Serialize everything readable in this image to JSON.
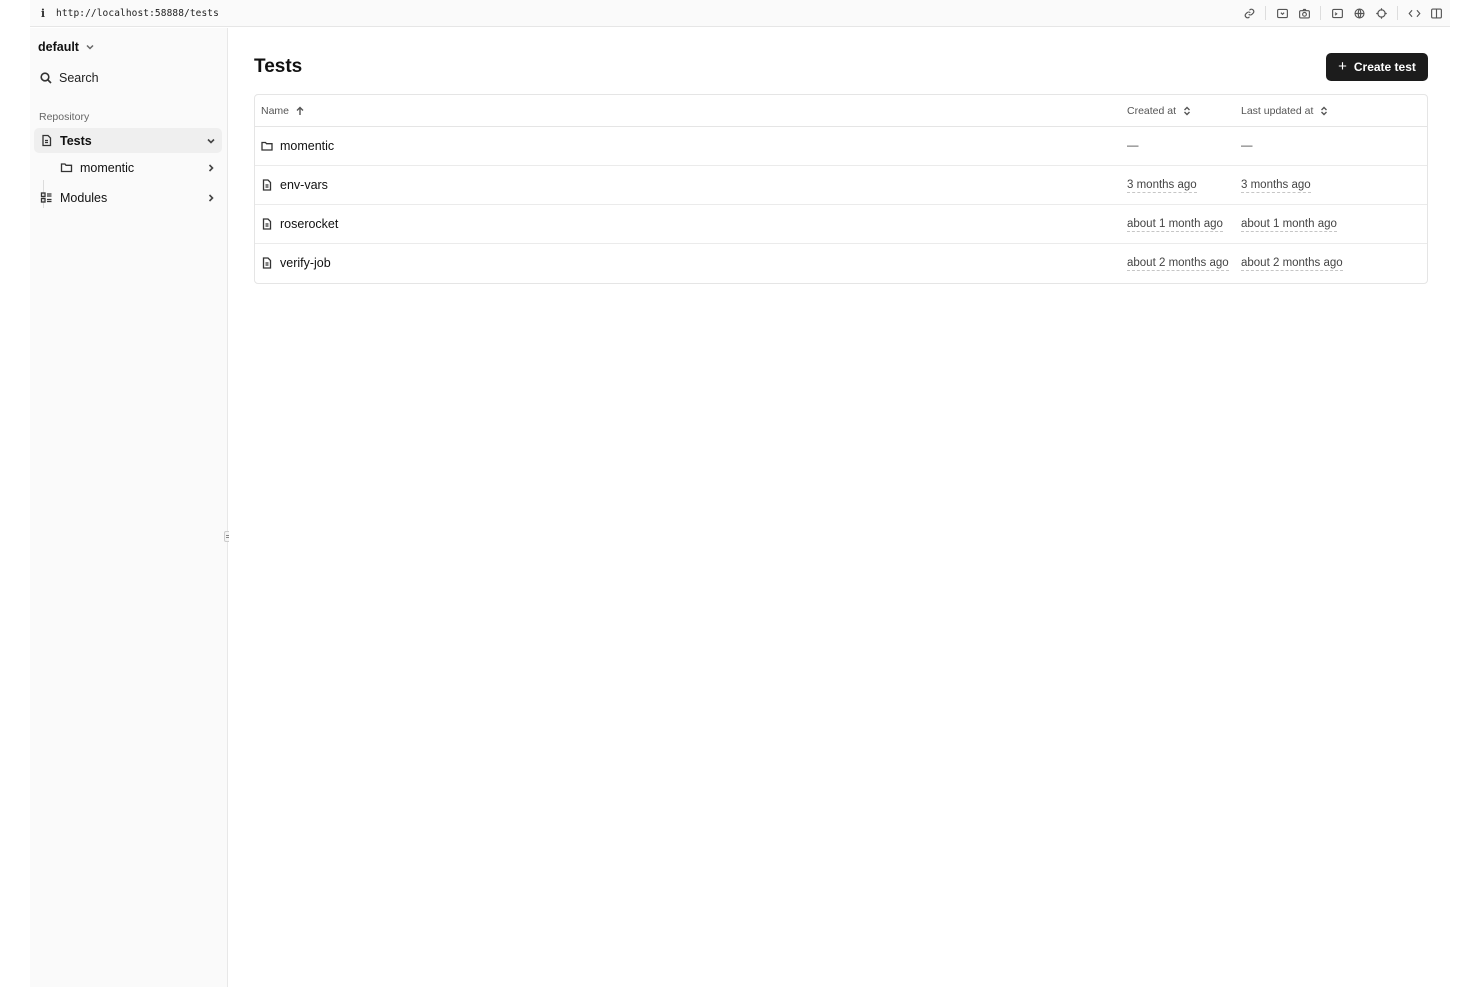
{
  "browser": {
    "url": "http://localhost:58888/tests",
    "info_glyph": "i",
    "tools": [
      "link-icon",
      "screenshot-area-icon",
      "camera-icon",
      "terminal-icon",
      "globe-icon",
      "crosshair-icon",
      "code-icon",
      "split-view-icon"
    ]
  },
  "sidebar": {
    "workspace": "default",
    "search_label": "Search",
    "section_label": "Repository",
    "items": [
      {
        "label": "Tests",
        "icon": "file-icon",
        "expanded": true
      },
      {
        "label": "momentic",
        "icon": "folder-icon",
        "expanded": false
      },
      {
        "label": "Modules",
        "icon": "modules-icon",
        "expanded": false
      }
    ]
  },
  "main": {
    "title": "Tests",
    "create_button": "Create test",
    "create_button_plus": "+",
    "table": {
      "columns": {
        "name": "Name",
        "created": "Created at",
        "updated": "Last updated at"
      },
      "rows": [
        {
          "name": "momentic",
          "type": "folder",
          "created": "—",
          "updated": "—"
        },
        {
          "name": "env-vars",
          "type": "file",
          "created": "3 months ago",
          "updated": "3 months ago"
        },
        {
          "name": "roserocket",
          "type": "file",
          "created": "about 1 month ago",
          "updated": "about 1 month ago"
        },
        {
          "name": "verify-job",
          "type": "file",
          "created": "about 2 months ago",
          "updated": "about 2 months ago"
        }
      ]
    }
  }
}
